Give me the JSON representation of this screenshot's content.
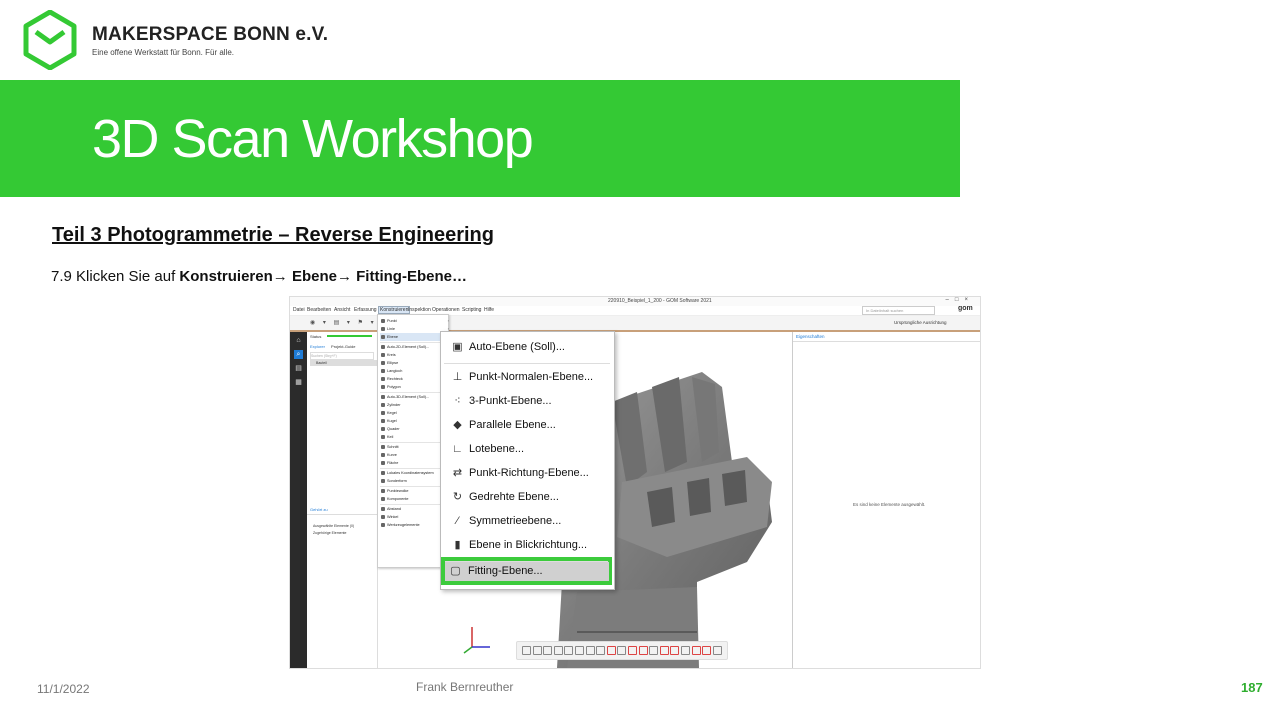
{
  "brand": {
    "name": "MAKERSPACE BONN e.V.",
    "tagline": "Eine offene Werkstatt für Bonn. Für alle.",
    "accent_color": "#34c934"
  },
  "slide": {
    "title": "3D Scan Workshop",
    "section": "Teil 3  Photogrammetrie  – Reverse Engineering",
    "instruction_prefix": "7.9 Klicken Sie auf ",
    "step1": "Konstruieren",
    "step2": "Ebene",
    "step3": "Fitting-Ebene…",
    "arrow": "→"
  },
  "app": {
    "window_title": "220910_Beispiel_1_200 - GOM Software 2021",
    "window_buttons": "–□×",
    "menus": [
      "Datei",
      "Bearbeiten",
      "Ansicht",
      "Erfassung",
      "Konstruieren",
      "Inspektion",
      "Operationen",
      "Scripting",
      "Hilfe"
    ],
    "active_menu": "Konstruieren",
    "search_placeholder": "In Dateiinhalt suchen",
    "brand_mark": "gom",
    "alignment_label": "Ursprüngliche Ausrichtung",
    "sidebar_icons": [
      "home-icon",
      "search-icon",
      "document-icon",
      "grid-icon"
    ],
    "explorer": {
      "status": "Status",
      "tabs": [
        "Explorer",
        "Projekt-Guide"
      ],
      "search_placeholder": "Suchen (Strg+F)",
      "node": "Bauteil",
      "panel2_tab": "Gehört zu",
      "items": [
        "Ausgewählte Elemente (0)",
        "Zugehörige Elemente"
      ]
    },
    "construct_menu": [
      {
        "label": "Punkt",
        "submenu": true
      },
      {
        "label": "Linie",
        "submenu": true
      },
      {
        "label": "Ebene",
        "submenu": true,
        "highlight": true
      },
      {
        "sep": true
      },
      {
        "label": "Auto-2D-Element (Soll)...",
        "submenu": false
      },
      {
        "label": "Kreis",
        "submenu": true
      },
      {
        "label": "Ellipse",
        "submenu": true
      },
      {
        "label": "Langloch",
        "submenu": true
      },
      {
        "label": "Rechteck",
        "submenu": true
      },
      {
        "label": "Polygon",
        "submenu": true
      },
      {
        "sep": true
      },
      {
        "label": "Auto-3D-Element (Soll)...",
        "submenu": false
      },
      {
        "label": "Zylinder",
        "submenu": true
      },
      {
        "label": "Kegel",
        "submenu": true
      },
      {
        "label": "Kugel",
        "submenu": true
      },
      {
        "label": "Quader",
        "submenu": true
      },
      {
        "label": "Keil",
        "submenu": true
      },
      {
        "sep": true
      },
      {
        "label": "Schnitt",
        "submenu": true
      },
      {
        "label": "Kurve",
        "submenu": true
      },
      {
        "label": "Fläche",
        "submenu": true
      },
      {
        "sep": true
      },
      {
        "label": "Lokales Koordinatensystem",
        "submenu": true
      },
      {
        "label": "Sonderform",
        "submenu": true
      },
      {
        "sep": true
      },
      {
        "label": "Punktewolke",
        "submenu": true
      },
      {
        "label": "Komponente",
        "submenu": true
      },
      {
        "sep": true
      },
      {
        "label": "Abstand",
        "submenu": true
      },
      {
        "label": "Winkel",
        "submenu": true
      },
      {
        "label": "Werkzeugelemente",
        "submenu": true
      }
    ],
    "plane_submenu": [
      {
        "label": "Auto-Ebene (Soll)...",
        "icon": "▣"
      },
      {
        "sep": true
      },
      {
        "label": "Punkt-Normalen-Ebene...",
        "icon": "⊥"
      },
      {
        "label": "3-Punkt-Ebene...",
        "icon": "⁖"
      },
      {
        "label": "Parallele Ebene...",
        "icon": "◆"
      },
      {
        "label": "Lotebene...",
        "icon": "∟"
      },
      {
        "label": "Punkt-Richtung-Ebene...",
        "icon": "⇄"
      },
      {
        "label": "Gedrehte Ebene...",
        "icon": "↻"
      },
      {
        "label": "Symmetrieebene...",
        "icon": "⁄"
      },
      {
        "label": "Ebene in Blickrichtung...",
        "icon": "▮"
      },
      {
        "sep": true
      }
    ],
    "fitting_item": {
      "label": "Fitting-Ebene...",
      "icon": "▢"
    },
    "properties": {
      "tab": "Eigenschaften",
      "empty_text": "Es sind keine Elemente ausgewählt."
    }
  },
  "footer": {
    "date": "11/1/2022",
    "author": "Frank Bernreuther",
    "page": "187"
  }
}
